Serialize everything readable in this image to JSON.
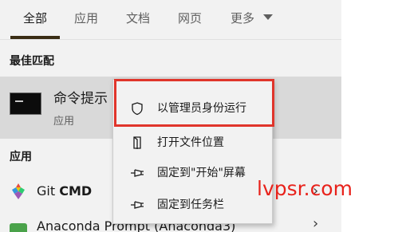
{
  "tabs": [
    {
      "label": "全部",
      "active": true
    },
    {
      "label": "应用",
      "active": false
    },
    {
      "label": "文档",
      "active": false
    },
    {
      "label": "网页",
      "active": false
    },
    {
      "label": "更多",
      "active": false
    }
  ],
  "sections": {
    "best_match": "最佳匹配",
    "apps": "应用"
  },
  "best_match_item": {
    "title": "命令提示",
    "subtitle": "应用",
    "icon": "command-prompt-icon"
  },
  "context_menu": [
    {
      "label": "以管理员身份运行",
      "icon": "shield-icon",
      "highlighted": true
    },
    {
      "label": "打开文件位置",
      "icon": "folder-file-icon"
    },
    {
      "label": "固定到\"开始\"屏幕",
      "icon": "pin-icon"
    },
    {
      "label": "固定到任务栏",
      "icon": "pin-icon"
    }
  ],
  "app_list": [
    {
      "label_prefix": "Git ",
      "label_bold": "CMD",
      "icon": "git-gem-icon"
    },
    {
      "label_prefix": "Anaconda Prompt (Anaconda3)",
      "label_bold": "",
      "icon": "anaconda-icon"
    }
  ],
  "watermark": "lvpsr.com",
  "colors": {
    "highlight_border": "#e0352b",
    "watermark": "#e8221b",
    "active_tab_underline": "#3a2d14",
    "panel_bg": "#f2f2f2",
    "selected_row_bg": "#d9d9d9"
  }
}
